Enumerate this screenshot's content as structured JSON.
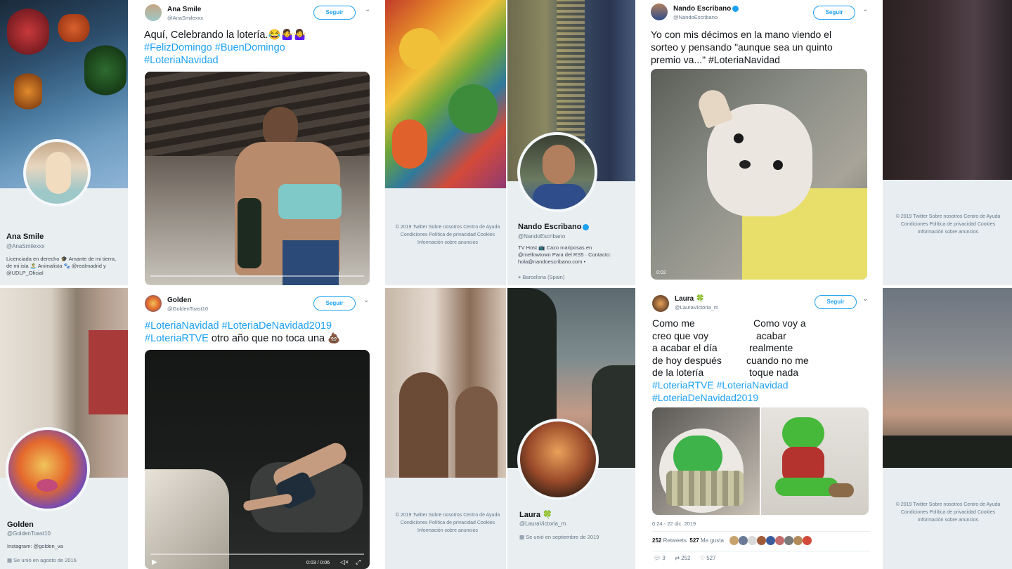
{
  "tweets": {
    "ana": {
      "name": "Ana Smile",
      "handle": "@AnaSmilexxx",
      "follow": "Seguir",
      "chevron": "⌄",
      "text": "Aquí, Celebrando la lotería.",
      "emoji": "😂🤷‍♀️🤷‍♀️",
      "hashtags": [
        "#FelizDomingo",
        "#BuenDomingo",
        "#LoteriaNavidad"
      ]
    },
    "nando": {
      "name": "Nando Escribano",
      "handle": "@NandoEscribano",
      "follow": "Seguir",
      "chevron": "⌄",
      "text_lines": [
        "Yo con mis décimos en la mano viendo el",
        "sorteo y pensando \"aunque sea un quinto",
        "premio va...\""
      ],
      "hashtag": "#LoteriaNavidad",
      "video_time": "0:02"
    },
    "golden": {
      "name": "Golden",
      "handle": "@GoldenToast10",
      "follow": "Seguir",
      "chevron": "⌄",
      "hashtags_line1": [
        "#LoteriaNavidad",
        "#LoteriaDeNavidad2019"
      ],
      "hashtag_line2": "#LoteriaRTVE",
      "text": "otro año que no toca una",
      "emoji": "💩",
      "video_time": "0:03 / 0:06"
    },
    "laura": {
      "name": "Laura",
      "handle": "@LauraVictoria_m",
      "follow": "Seguir",
      "chevron": "⌄",
      "clover": "🍀",
      "left_lines": [
        "Como me",
        "creo que voy",
        "a acabar el día",
        "de hoy después",
        "de la lotería"
      ],
      "right_lines": [
        "Como voy a",
        "acabar",
        "realmente",
        "cuando no me",
        "toque nada"
      ],
      "hashtags_line1": [
        "#LoteriaRTVE",
        "#LoteriaNavidad"
      ],
      "hashtag_line2": "#LoteriaDeNavidad2019",
      "timestamp": "0:24 - 22 dic. 2019",
      "retweets_count": "252",
      "retweets_label": "Retweets",
      "likes_count": "527",
      "likes_label": "Me gusta",
      "reply_count": "3",
      "rt_count": "252",
      "like_count": "527"
    }
  },
  "profiles": {
    "ana": {
      "name": "Ana Smile",
      "handle": "@AnaSmilexxx",
      "bio": "Licenciada en derecho 🎓 Amante de mi tierra, de mi isla 🏝️ Animalista 🐾 @realmadrid y @UDLP_Oficial",
      "link1": "@realmadrid",
      "link2": "@UDLP_Oficial"
    },
    "nando": {
      "name": "Nando Escribano",
      "handle": "@NandoEscribano",
      "bio": "TV Host 📺 Cazo mariposas en @mellowtown Para del RS5 · Contacto: hola@nandoescribano.com •",
      "location": "Barcelona (Spain)"
    },
    "golden": {
      "name": "Golden",
      "handle": "@GoldenToast10",
      "bio": "Instagram: @golden_va",
      "joined": "Se unió en agosto de 2016"
    },
    "laura": {
      "name": "Laura",
      "handle": "@LauraVictoria_m",
      "joined": "Se unió en septiembre de 2019"
    }
  },
  "footers": {
    "a": [
      "© 2019 Twitter  Sobre nosotros  Centro de Ayuda",
      "Condiciones  Política de privacidad  Cookies",
      "Información sobre anuncios"
    ],
    "b": [
      "© 2019 Twitter  Sobre nosotros  Centro de Ayuda",
      "Condiciones  Política de privacidad  Cookies",
      "Información sobre anuncios"
    ],
    "c": [
      "© 2019 Twitter  Sobre nosotros  Centro de Ayuda",
      "Condiciones  Política de privacidad  Cookies",
      "Información sobre anuncios"
    ],
    "d": [
      "© 2019 Twitter  Sobre nosotros  Centro de Ayuda",
      "Condiciones  Política de privacidad  Cookies",
      "Información sobre anuncios"
    ]
  },
  "colors": {
    "accent": "#1da1f2",
    "text": "#14171a",
    "muted": "#657786"
  },
  "icons": [
    "verified-badge-icon",
    "play-icon",
    "mute-icon",
    "fullscreen-icon",
    "reply-icon",
    "retweet-icon",
    "like-icon",
    "location-icon",
    "calendar-icon"
  ]
}
